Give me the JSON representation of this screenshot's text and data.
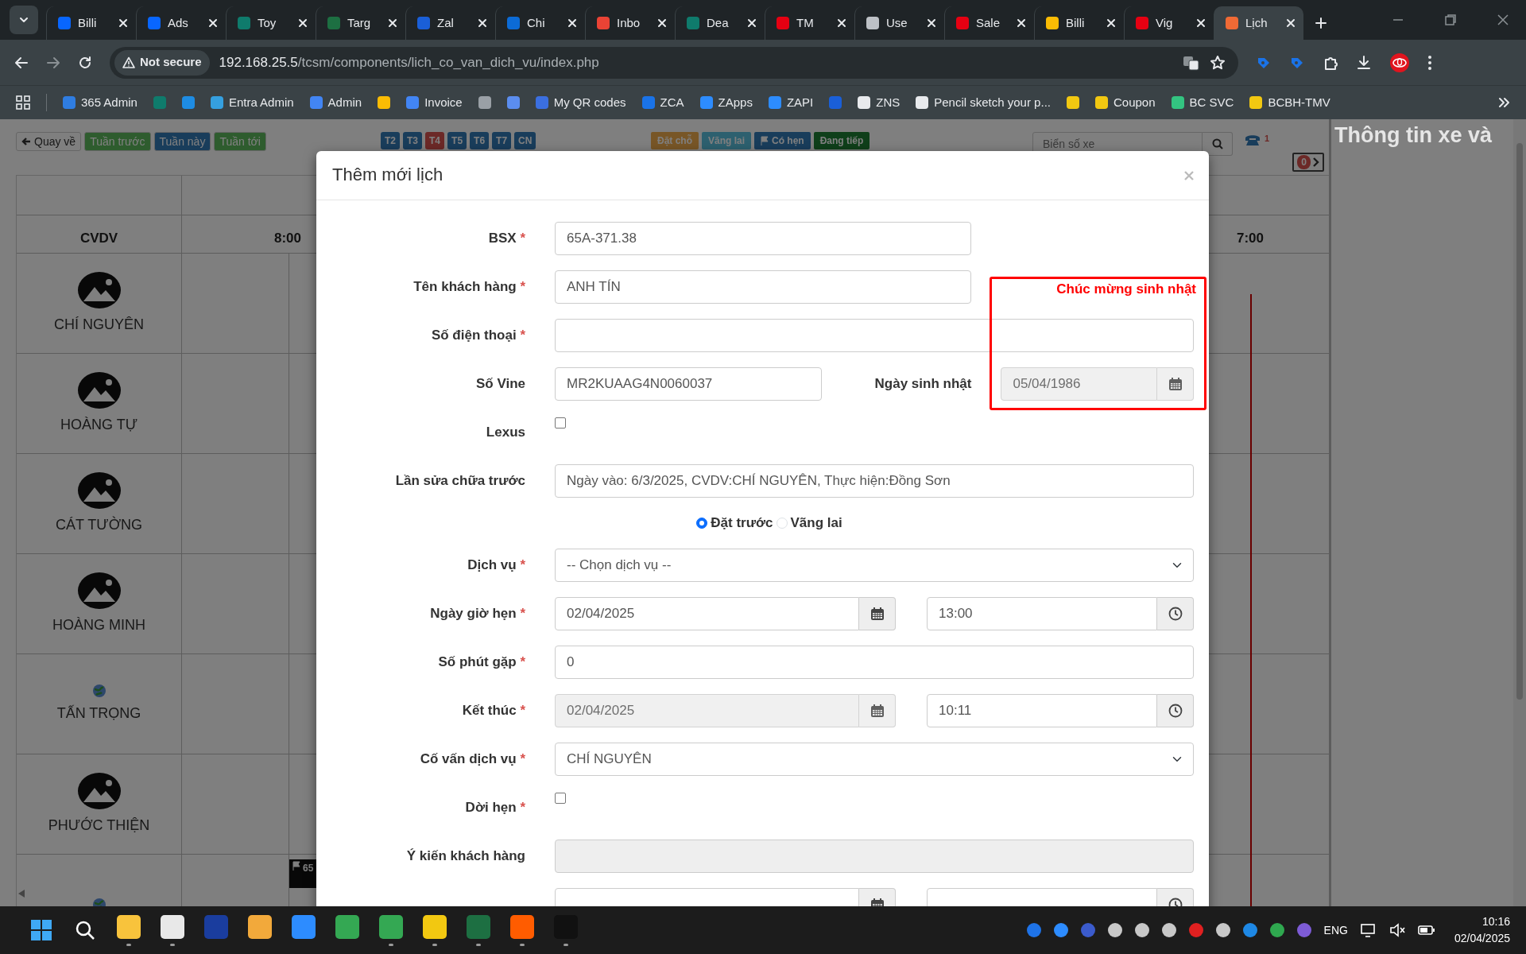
{
  "browser": {
    "tabs": [
      {
        "title": "Billi",
        "color": "#0866ff",
        "selected": false
      },
      {
        "title": "Ads",
        "color": "#0866ff",
        "selected": false
      },
      {
        "title": "Toy",
        "color": "#0f7b6c",
        "selected": false
      },
      {
        "title": "Targ",
        "color": "#1d6f42",
        "selected": false
      },
      {
        "title": "Zal",
        "color": "#1a5fd8",
        "selected": false
      },
      {
        "title": "Chi",
        "color": "#0c6bd6",
        "selected": false
      },
      {
        "title": "Inbo",
        "color": "#ea4335",
        "selected": false
      },
      {
        "title": "Dea",
        "color": "#0f7b6c",
        "selected": false
      },
      {
        "title": "TM",
        "color": "#e60012",
        "selected": false
      },
      {
        "title": "Use",
        "color": "#bdc1c6",
        "selected": false
      },
      {
        "title": "Sale",
        "color": "#e60012",
        "selected": false
      },
      {
        "title": "Billi",
        "color": "#fbbc04",
        "selected": false
      },
      {
        "title": "Vig",
        "color": "#e60012",
        "selected": false
      },
      {
        "title": "Lịch",
        "color": "#f06a35",
        "selected": true
      }
    ],
    "security": "Not secure",
    "url_host": "192.168.25.5",
    "url_path": "/tcsm/components/lich_co_van_dich_vu/index.php",
    "bookmarks": [
      {
        "label": "365 Admin",
        "color": "#2f7de1"
      },
      {
        "color": "#0f7b6c"
      },
      {
        "color": "#1e8ce3"
      },
      {
        "label": "Entra Admin",
        "color": "#35a0e0"
      },
      {
        "label": "Admin",
        "color": "#4285f4"
      },
      {
        "color": "#fbbc04"
      },
      {
        "label": "Invoice",
        "color": "#4285f4"
      },
      {
        "color": "#9aa0a6"
      },
      {
        "color": "#5b8def"
      },
      {
        "label": "My QR codes",
        "color": "#3b6fe0"
      },
      {
        "label": "ZCA",
        "color": "#1a73e8"
      },
      {
        "label": "ZApps",
        "color": "#2d8cff"
      },
      {
        "label": "ZAPI",
        "color": "#2d8cff"
      },
      {
        "color": "#1a5fd8"
      },
      {
        "label": "ZNS",
        "color": "#e8eaed"
      },
      {
        "label": "Pencil sketch your p...",
        "color": "#e8eaed"
      },
      {
        "color": "#f2c811"
      },
      {
        "label": "Coupon",
        "color": "#f2c811"
      },
      {
        "label": "BC SVC",
        "color": "#33c481"
      },
      {
        "label": "BCBH-TMV",
        "color": "#f2c811"
      }
    ]
  },
  "page": {
    "nav_buttons": [
      {
        "label": "Quay về",
        "kind": "back"
      },
      {
        "label": "Tuần trước",
        "kind": "previous"
      },
      {
        "label": "Tuần này",
        "kind": "current"
      },
      {
        "label": "Tuần tới",
        "kind": "next"
      }
    ],
    "days": [
      {
        "label": "T2",
        "selected": false
      },
      {
        "label": "T3",
        "selected": false
      },
      {
        "label": "T4",
        "selected": true
      },
      {
        "label": "T5",
        "selected": false
      },
      {
        "label": "T6",
        "selected": false
      },
      {
        "label": "T7",
        "selected": false
      },
      {
        "label": "CN",
        "selected": false
      }
    ],
    "legend": [
      {
        "label": "Đặt chỗ",
        "kind": "booked"
      },
      {
        "label": "Vãng lai",
        "kind": "walk_in"
      },
      {
        "label": "Có hẹn",
        "kind": "appointment"
      },
      {
        "label": "Đang tiếp",
        "kind": "in_service"
      }
    ],
    "search": {
      "placeholder": "Biển số xe"
    },
    "phone_count": "1",
    "queue_count": "0",
    "side_panel": {
      "title": "Thông tin xe và"
    },
    "calendar": {
      "header": "CVDV",
      "hours": [
        "8:00",
        "7:00"
      ],
      "advisors": [
        {
          "name": "CHÍ NGUYÊN",
          "kind": "photo"
        },
        {
          "name": "HOÀNG TỰ",
          "kind": "photo"
        },
        {
          "name": "CÁT TƯỜNG",
          "kind": "photo"
        },
        {
          "name": "HOÀNG MINH",
          "kind": "photo"
        },
        {
          "name": "TẤN TRỌNG",
          "kind": "globe"
        },
        {
          "name": "PHƯỚC THIỆN",
          "kind": "photo"
        },
        {
          "kind": "globe",
          "events": [
            {
              "label": "65"
            }
          ]
        }
      ]
    }
  },
  "modal": {
    "title": "Thêm mới lịch",
    "birthday_notice": "Chúc mừng sinh nhật",
    "rows": [
      {
        "kind": "short_text",
        "label": "BSX",
        "mark": "*",
        "value": "65A-371.38"
      },
      {
        "kind": "short_text",
        "label": "Tên khách hàng",
        "mark": "*",
        "value": "ANH TÍN"
      },
      {
        "kind": "text",
        "label": "Số điện thoại",
        "mark": "*"
      },
      {
        "kind": "text_date_pair",
        "label": "Số Vine",
        "value": "MR2KUAAG4N0060037",
        "label2": "Ngày sinh nhật",
        "date": "05/04/1986",
        "disabled": true
      },
      {
        "kind": "checkbox",
        "label": "Lexus",
        "checked": false
      },
      {
        "kind": "text",
        "label": "Lần sửa chữa trước",
        "value": "Ngày vào: 6/3/2025, CVDV:CHÍ NGUYÊN, Thực hiện:Đồng Sơn"
      },
      {
        "kind": "radio_group",
        "options": [
          {
            "label": "Đặt trước",
            "selected": true
          },
          {
            "label": "Vãng lai",
            "selected": false
          }
        ]
      },
      {
        "kind": "select",
        "label": "Dịch vụ",
        "mark": "*",
        "value": "-- Chọn dịch vụ --"
      },
      {
        "kind": "datetime",
        "label": "Ngày giờ hẹn",
        "mark": "*",
        "date": "02/04/2025",
        "time": "13:00",
        "disabled": false
      },
      {
        "kind": "text",
        "label": "Số phút gặp",
        "mark": "*",
        "value": "0"
      },
      {
        "kind": "datetime",
        "label": "Kết thúc",
        "mark": "*",
        "date": "02/04/2025",
        "time": "10:11",
        "disabled": true
      },
      {
        "kind": "select",
        "label": "Cố vấn dịch vụ",
        "mark": "*",
        "value": "CHÍ NGUYÊN"
      },
      {
        "kind": "checkbox",
        "label": "Dời hẹn",
        "mark": "*",
        "checked": false
      },
      {
        "kind": "text",
        "label": "Ý kiến khách hàng",
        "disabled": true
      },
      {
        "kind": "datetime",
        "disabled": false
      }
    ]
  },
  "taskbar": {
    "apps": [
      {
        "color": "#f8c33c",
        "running": true
      },
      {
        "color": "#e8e8e8",
        "running": true
      },
      {
        "color": "#1a3d9e",
        "running": false
      },
      {
        "color": "#f2a93b",
        "running": false
      },
      {
        "color": "#2d8cff",
        "running": false
      },
      {
        "color": "#34a853",
        "running": false
      },
      {
        "color": "#34a853",
        "running": true
      },
      {
        "color": "#f2c811",
        "running": true
      },
      {
        "color": "#1d6f42",
        "running": true
      },
      {
        "color": "#ff5c00",
        "running": true
      },
      {
        "color": "#111111",
        "running": true
      }
    ],
    "tray": [
      {
        "color": "#1e73e8"
      },
      {
        "color": "#2d8cff"
      },
      {
        "color": "#3b5bcc"
      },
      {
        "color": "#c8c8c8"
      },
      {
        "color": "#c8c8c8"
      },
      {
        "color": "#c8c8c8"
      },
      {
        "color": "#e02020"
      },
      {
        "color": "#c8c8c8"
      },
      {
        "color": "#1e88e5"
      },
      {
        "color": "#2fa84f"
      },
      {
        "color": "#7d5bd6"
      }
    ],
    "language": "ENG",
    "time": "10:16",
    "date": "02/04/2025"
  }
}
